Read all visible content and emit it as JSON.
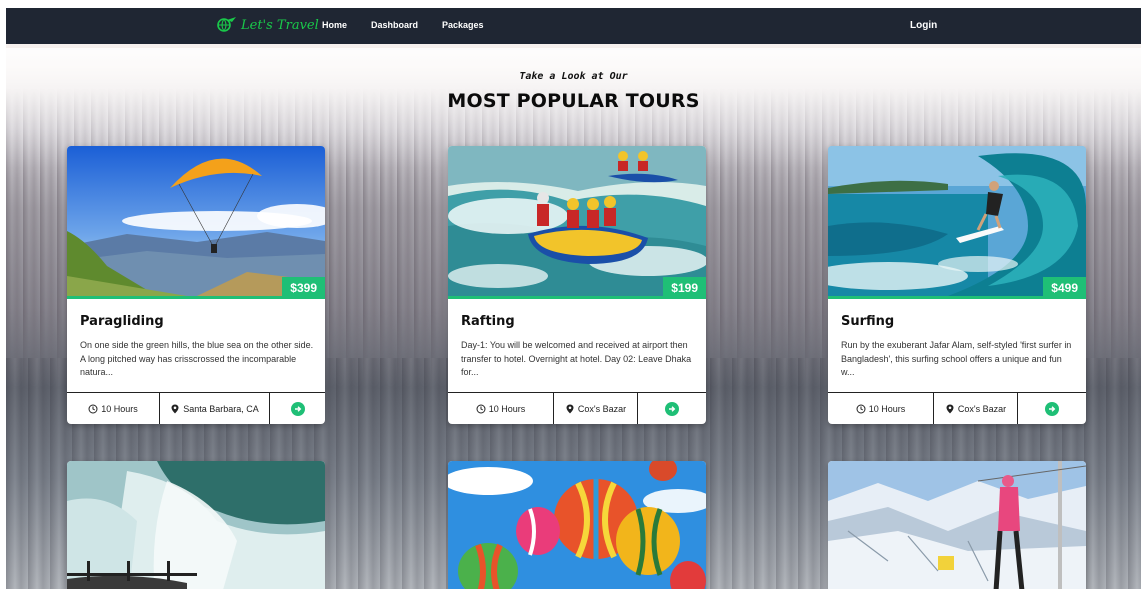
{
  "navbar": {
    "brand": "Let's Travel",
    "links": [
      "Home",
      "Dashboard",
      "Packages"
    ],
    "login": "Login"
  },
  "heading": {
    "eyebrow": "Take a Look at Our",
    "title": "MOST POPULAR TOURS"
  },
  "tours": [
    {
      "title": "Paragliding",
      "price": "$399",
      "description": "On one side the green hills, the blue sea on the other side. A long pitched way has crisscrossed the incomparable natura...",
      "duration": "10 Hours",
      "location": "Santa Barbara, CA"
    },
    {
      "title": "Rafting",
      "price": "$199",
      "description": "Day-1: You will be welcomed and received at airport then transfer to hotel. Overnight at hotel. Day 02: Leave Dhaka for...",
      "duration": "10 Hours",
      "location": "Cox's Bazar"
    },
    {
      "title": "Surfing",
      "price": "$499",
      "description": "Run by the exuberant Jafar Alam, self-styled 'first surfer in Bangladesh', this surfing school offers a unique and fun w...",
      "duration": "10 Hours",
      "location": "Cox's Bazar"
    }
  ],
  "colors": {
    "navbar": "#1f2633",
    "brand": "#19c94a",
    "accent": "#1fbf76"
  },
  "icons": {
    "brand": "globe-plane-icon",
    "duration": "clock-icon",
    "location": "map-marker-icon",
    "go": "arrow-circle-right-icon"
  }
}
